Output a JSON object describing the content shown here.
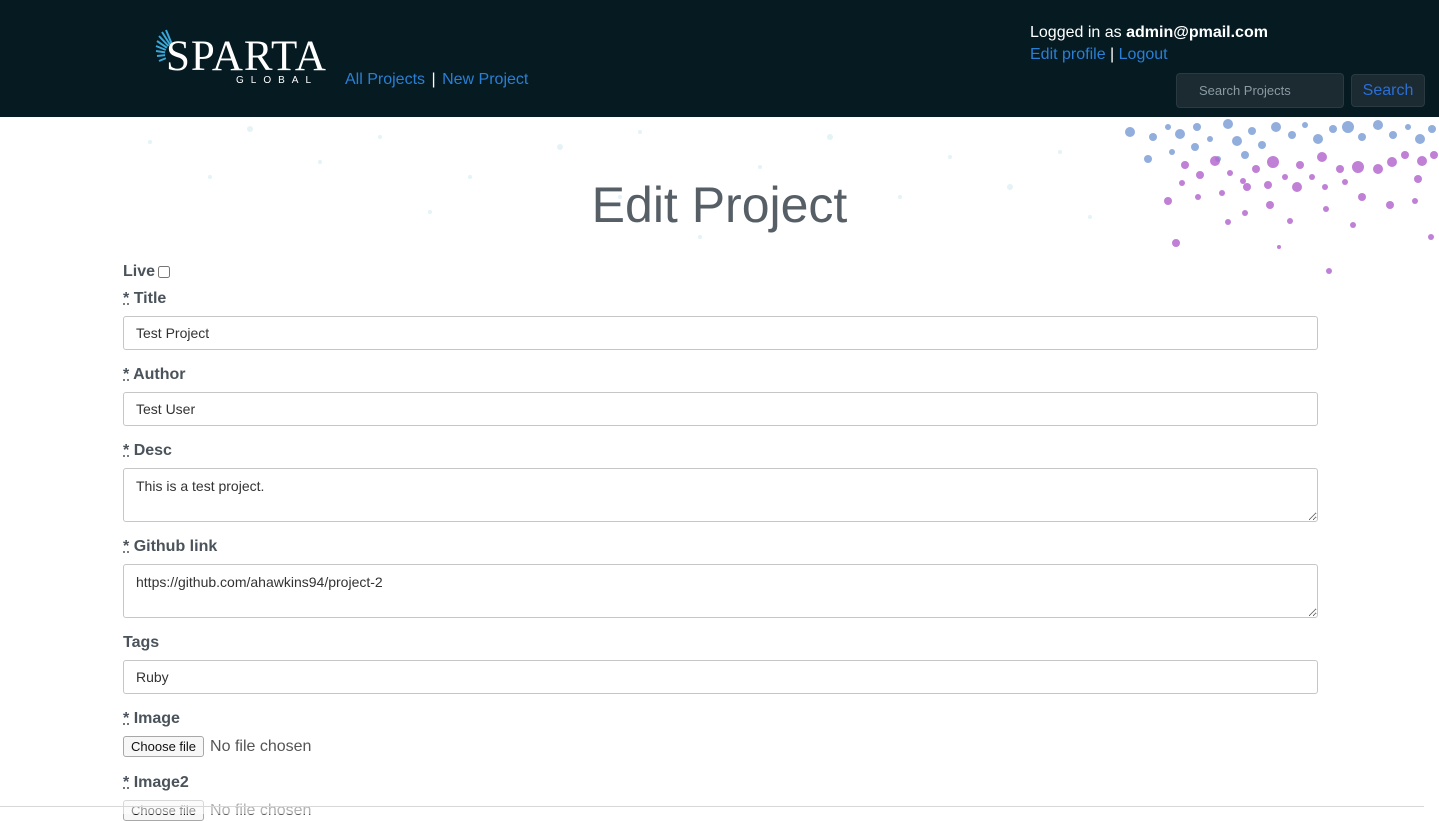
{
  "header": {
    "logo_text": "SPARTA",
    "logo_sub": "GLOBAL",
    "nav": {
      "all_projects": "All Projects",
      "separator": "|",
      "new_project": "New Project"
    },
    "user": {
      "logged_in_prefix": "Logged in as",
      "email": "admin@pmail.com",
      "edit_profile": "Edit profile",
      "separator": "|",
      "logout": "Logout"
    },
    "search": {
      "placeholder": "Search Projects",
      "value": "",
      "button_label": "Search"
    }
  },
  "page": {
    "title": "Edit Project"
  },
  "form": {
    "live": {
      "label": "Live",
      "checked": false
    },
    "required_mark": "*",
    "title": {
      "label": "Title",
      "value": "Test Project"
    },
    "author": {
      "label": "Author",
      "value": "Test User"
    },
    "desc": {
      "label": "Desc",
      "value": "This is a test project."
    },
    "github": {
      "label": "Github link",
      "value": "https://github.com/ahawkins94/project-2"
    },
    "tags": {
      "label": "Tags",
      "value": "Ruby"
    },
    "image": {
      "label": "Image",
      "button": "Choose file",
      "status": "No file chosen"
    },
    "image2": {
      "label": "Image2",
      "button": "Choose file",
      "status": "No file chosen"
    }
  },
  "colors": {
    "header_bg": "#051a21",
    "link": "#2a7fd4",
    "title_text": "#565e66"
  },
  "icons": {
    "logo": "sparta-fan-icon"
  }
}
